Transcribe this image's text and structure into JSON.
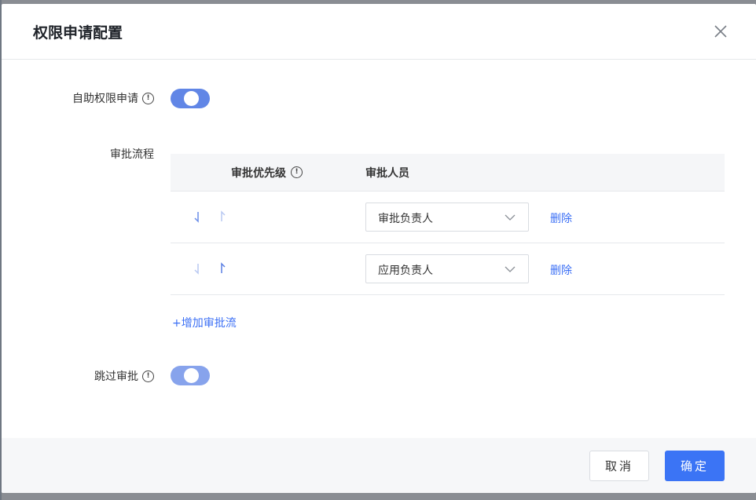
{
  "dialog": {
    "title": "权限申请配置",
    "close_icon": "close-icon"
  },
  "self_apply": {
    "label": "自助权限申请",
    "info_icon": "info-icon",
    "info_glyph": "!",
    "enabled": true
  },
  "approval_flow": {
    "label": "审批流程",
    "columns": {
      "priority": "审批优先级",
      "approver": "审批人员"
    },
    "rows": [
      {
        "approver": "审批负责人",
        "delete_label": "删除",
        "down_arrow": "arrow-down-icon",
        "up_arrow": "arrow-up-icon"
      },
      {
        "approver": "应用负责人",
        "delete_label": "删除",
        "down_arrow": "arrow-down-icon",
        "up_arrow": "arrow-up-icon"
      }
    ],
    "add_label": "+增加审批流"
  },
  "skip_approval": {
    "label": "跳过审批",
    "enabled": true
  },
  "footer": {
    "cancel_label": "取消",
    "ok_label": "确定"
  },
  "colors": {
    "primary": "#3b74f5",
    "toggle_on": "#6186e6",
    "link": "#3b6ff5"
  }
}
